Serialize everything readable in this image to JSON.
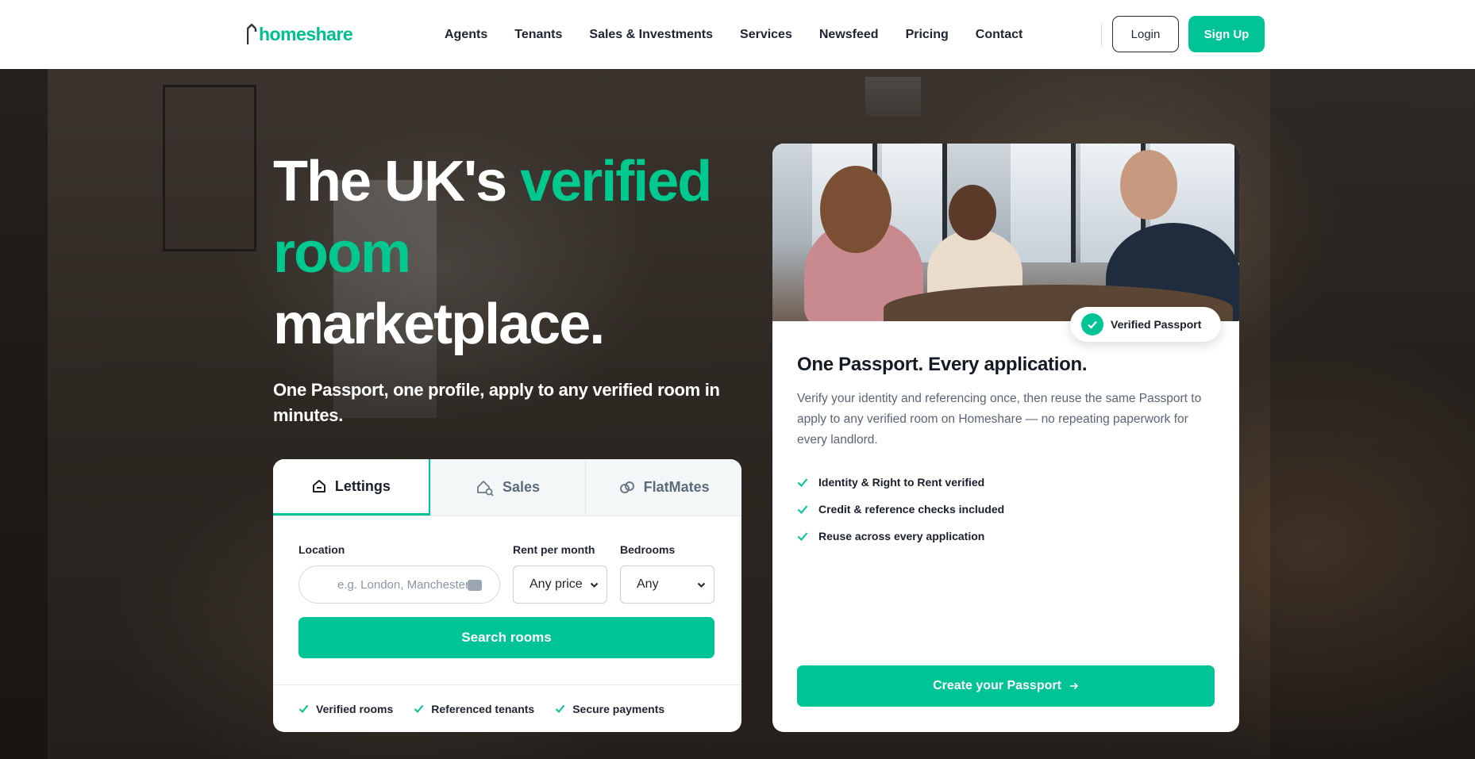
{
  "brand": {
    "name": "homeshare",
    "accent": "#00c495"
  },
  "nav": {
    "links": [
      "Agents",
      "Tenants",
      "Sales & Investments",
      "Services",
      "Newsfeed",
      "Pricing",
      "Contact"
    ],
    "login_label": "Login",
    "signup_label": "Sign Up"
  },
  "hero": {
    "headline_part1": "The UK's ",
    "headline_accent": "verified room",
    "headline_part2": "marketplace.",
    "subheading": "One Passport, one profile, apply to any verified room in minutes."
  },
  "search": {
    "tabs": [
      {
        "label": "Lettings",
        "icon": "home-icon",
        "active": true
      },
      {
        "label": "Sales",
        "icon": "house-search-icon",
        "active": false
      },
      {
        "label": "FlatMates",
        "icon": "link-icon",
        "active": false
      }
    ],
    "location_label": "Location",
    "location_placeholder": "e.g. London, Manchester, B",
    "rent_label": "Rent per month",
    "rent_value": "Any price",
    "bedrooms_label": "Bedrooms",
    "bedrooms_value": "Any",
    "button_label": "Search rooms",
    "features": [
      "Verified rooms",
      "Referenced tenants",
      "Secure payments"
    ]
  },
  "passport": {
    "badge_label": "Verified Passport",
    "title": "One Passport. Every application.",
    "description": "Verify your identity and referencing once, then reuse the same Passport to apply to any verified room on Homeshare — no repeating paperwork for every landlord.",
    "checklist": [
      "Identity & Right to Rent verified",
      "Credit & reference checks included",
      "Reuse across every application"
    ],
    "cta_label": "Create your Passport",
    "cta_icon": "arrow-right-icon"
  }
}
